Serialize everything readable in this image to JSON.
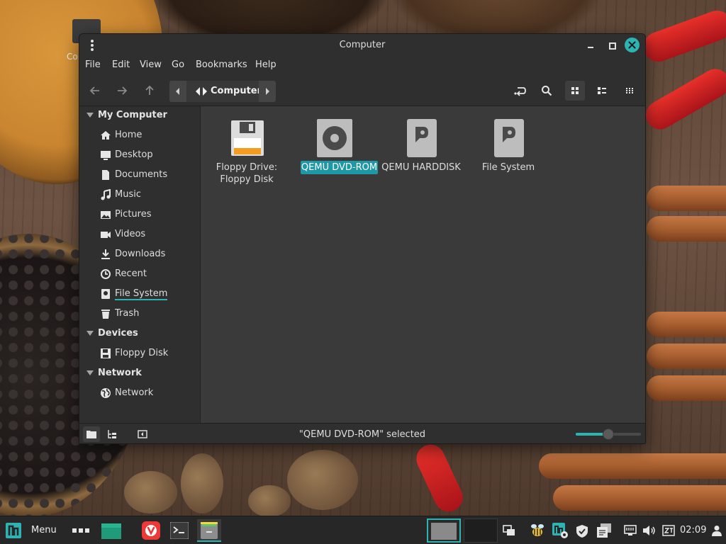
{
  "desktop": {
    "icon_label": "Co"
  },
  "window": {
    "title": "Computer",
    "menu": [
      "File",
      "Edit",
      "View",
      "Go",
      "Bookmarks",
      "Help"
    ],
    "path": {
      "crumb": "Computer"
    },
    "sidebar": {
      "sections": [
        {
          "label": "My Computer",
          "items": [
            "Home",
            "Desktop",
            "Documents",
            "Music",
            "Pictures",
            "Videos",
            "Downloads",
            "Recent",
            "File System",
            "Trash"
          ]
        },
        {
          "label": "Devices",
          "items": [
            "Floppy Disk"
          ]
        },
        {
          "label": "Network",
          "items": [
            "Network"
          ]
        }
      ]
    },
    "drives": [
      {
        "line1": "Floppy Drive:",
        "line2": "Floppy Disk",
        "icon": "floppy-drive-icon"
      },
      {
        "line1": "QEMU DVD-ROM",
        "line2": "",
        "icon": "optical-drive-icon",
        "selected": true
      },
      {
        "line1": "QEMU HARDDISK",
        "line2": "",
        "icon": "hard-disk-icon"
      },
      {
        "line1": "File System",
        "line2": "",
        "icon": "file-system-icon"
      }
    ],
    "status": "\"QEMU DVD-ROM\" selected",
    "zoom_level": 0.5,
    "accent_color": "#2eb3b3",
    "selection_color": "#1e98a6"
  },
  "taskbar": {
    "menu_label": "Menu",
    "clock": "02:09"
  }
}
